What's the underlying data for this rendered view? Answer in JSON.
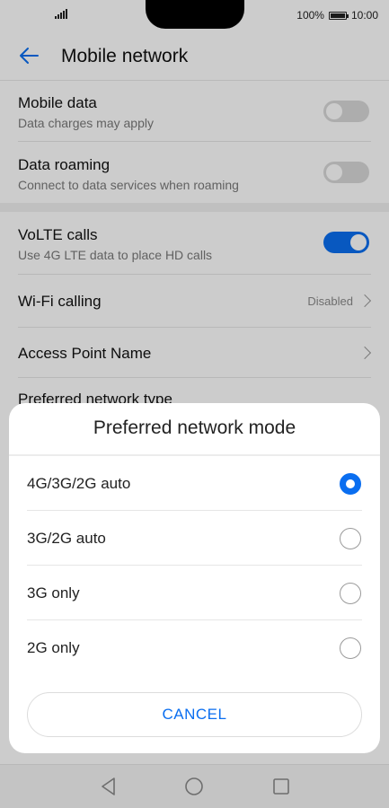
{
  "status_bar": {
    "battery": "100%",
    "time": "10:00"
  },
  "header": {
    "title": "Mobile network"
  },
  "settings": {
    "mobile_data": {
      "title": "Mobile data",
      "subtitle": "Data charges may apply",
      "enabled": false
    },
    "data_roaming": {
      "title": "Data roaming",
      "subtitle": "Connect to data services when roaming",
      "enabled": false
    },
    "volte": {
      "title": "VoLTE calls",
      "subtitle": "Use 4G LTE data to place HD calls",
      "enabled": true
    },
    "wifi_calling": {
      "title": "Wi-Fi calling",
      "value": "Disabled"
    },
    "apn": {
      "title": "Access Point Name"
    },
    "preferred_network": {
      "title": "Preferred network type"
    }
  },
  "dialog": {
    "title": "Preferred network mode",
    "options": [
      {
        "label": "4G/3G/2G auto",
        "selected": true
      },
      {
        "label": "3G/2G auto",
        "selected": false
      },
      {
        "label": "3G only",
        "selected": false
      },
      {
        "label": "2G only",
        "selected": false
      }
    ],
    "cancel_label": "CANCEL"
  },
  "colors": {
    "accent": "#0a6ef0",
    "overlay": "rgba(0,0,0,0.2)"
  },
  "nav_icons": [
    "back-triangle-icon",
    "home-circle-icon",
    "recents-square-icon"
  ]
}
